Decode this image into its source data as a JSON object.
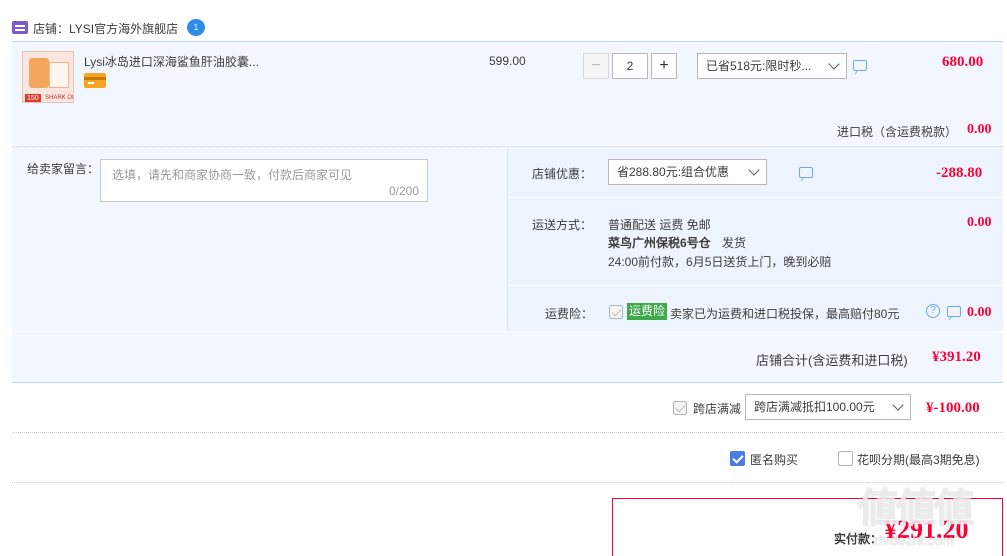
{
  "shop": {
    "label": "店铺：LYSI官方海外旗舰店",
    "badge": "1"
  },
  "item": {
    "title": "Lysi冰岛进口深海鲨鱼肝油胶囊...",
    "unit_price": "599.00",
    "quantity": "2",
    "minus": "−",
    "plus": "+",
    "promo_select": "已省518元:限时秒...",
    "subtotal": "680.00",
    "thumb_badge": "150",
    "thumb_caption": "SHARK OIL"
  },
  "tax": {
    "label": "进口税（含运费税款）",
    "value": "0.00"
  },
  "message": {
    "label": "给卖家留言：",
    "placeholder": "选填，请先和商家协商一致，付款后商家可见",
    "counter": "0/200"
  },
  "shop_discount": {
    "label": "店铺优惠：",
    "select": "省288.80元:组合优惠",
    "value": "-288.80"
  },
  "shipping": {
    "label": "运送方式：",
    "line1": "普通配送 运费 免邮",
    "line2_bold": "菜鸟广州保税6号仓",
    "line2_tail": "发货",
    "line3": "24:00前付款，6月5日送货上门，晚到必赔",
    "value": "0.00"
  },
  "insurance": {
    "label": "运费险：",
    "tag": "运费险",
    "text": "卖家已为运费和进口税投保，最高赔付80元",
    "value": "0.00"
  },
  "shop_total": {
    "label": "店铺合计(含运费和进口税)",
    "value": "¥391.20"
  },
  "cross_store": {
    "label": "跨店满减",
    "select": "跨店满减抵扣100.00元",
    "value": "¥-100.00"
  },
  "options": {
    "anonymous": "匿名购买",
    "huabei": "花呗分期(最高3期免息)"
  },
  "pay": {
    "label": "实付款：",
    "value": "¥291.20"
  },
  "watermark": {
    "glyphs": "値値値",
    "url": "zhidezhi.com"
  },
  "colors": {
    "price_red": "#ff0036",
    "accent_blue": "#4a7de2",
    "panel_blue": "#f2f7ff",
    "tag_green": "#3ea84a"
  }
}
